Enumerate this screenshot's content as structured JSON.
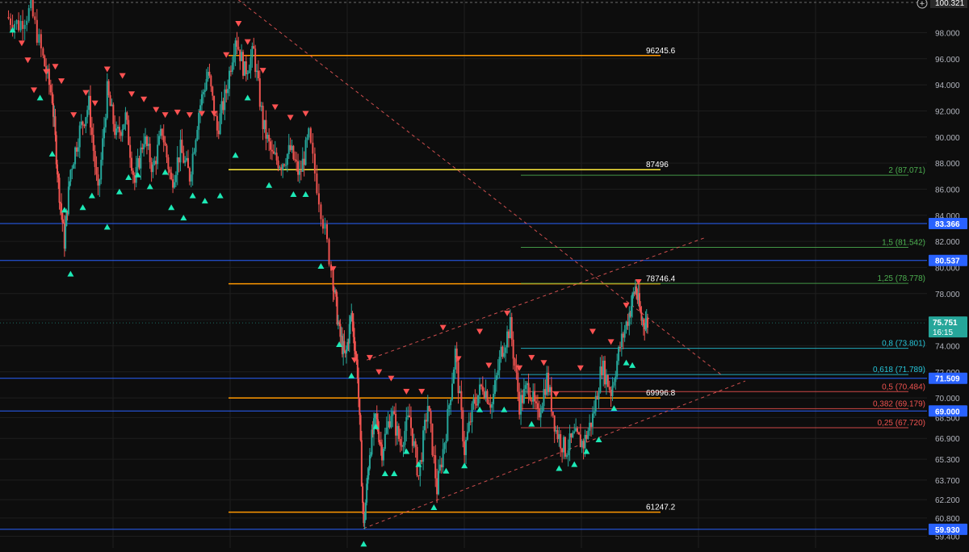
{
  "chart_data": {
    "type": "candlestick",
    "y_scale": "linear",
    "ylim": [
      58.5,
      100.5
    ],
    "grid": true,
    "colors": {
      "background": "#0d0d0d",
      "grid": "#1e1e1e",
      "axis_text": "#b2b5be",
      "up_candle": "#26a69a",
      "down_candle": "#ef5350",
      "pivot_high_marker": "#ff5252",
      "pivot_low_marker": "#1de9b6",
      "support_line": "#2962ff",
      "price_level": "#ff9800",
      "channel": "#f05a5a",
      "fib_upper": "#4caf50",
      "fib_mid": "#26c6da",
      "fib_lower": "#ef5350",
      "last_price_tag": "#26a69a",
      "yellow_level": "#ffeb3b"
    },
    "y_axis_ticks": [
      "98.000",
      "96.000",
      "94.000",
      "92.000",
      "90.000",
      "88.000",
      "86.000",
      "84.000",
      "82.000",
      "80.000",
      "78.000",
      "76.000",
      "74.000",
      "72.000",
      "70.000",
      "68.500",
      "66.900",
      "65.300",
      "63.700",
      "62.200",
      "60.800",
      "59.400"
    ],
    "y_axis_tick_values": [
      98,
      96,
      94,
      92,
      90,
      88,
      86,
      84,
      82,
      80,
      78,
      76,
      74,
      72,
      70,
      68.5,
      66.9,
      65.3,
      63.7,
      62.2,
      60.8,
      59.4
    ],
    "top_value_label": "100.321",
    "horizontal_support_lines": [
      {
        "label": "83.366",
        "value": 83.366
      },
      {
        "label": "80.537",
        "value": 80.537
      },
      {
        "label": "71.509",
        "value": 71.509
      },
      {
        "label": "69.000",
        "value": 69.0
      },
      {
        "label": "59.930",
        "value": 59.93
      }
    ],
    "price_levels": [
      {
        "label": "96245.6",
        "value": 96.2456,
        "color": "orange"
      },
      {
        "label": "87496",
        "value": 87.496,
        "color": "yellow"
      },
      {
        "label": "78746.4",
        "value": 78.7464,
        "color": "orange"
      },
      {
        "label": "69996.8",
        "value": 69.9968,
        "color": "orange"
      },
      {
        "label": "61247.2",
        "value": 61.2472,
        "color": "orange"
      }
    ],
    "fib_levels": [
      {
        "label": "2 (87.071)",
        "value": 87.071,
        "group": "upper"
      },
      {
        "label": "1,5 (81.542)",
        "value": 81.542,
        "group": "upper"
      },
      {
        "label": "1,25 (78.778)",
        "value": 78.778,
        "group": "upper"
      },
      {
        "label": "0,8 (73.801)",
        "value": 73.801,
        "group": "mid"
      },
      {
        "label": "0,618 (71.789)",
        "value": 71.789,
        "group": "mid"
      },
      {
        "label": "0,5 (70.484)",
        "value": 70.484,
        "group": "lower"
      },
      {
        "label": "0,382 (69.179)",
        "value": 69.179,
        "group": "lower"
      },
      {
        "label": "0,25 (67.720)",
        "value": 67.72,
        "group": "lower"
      }
    ],
    "last_price": {
      "value": 75.751,
      "label": "75.751",
      "countdown": "16:15"
    },
    "price_series": [
      {
        "t": 0.0,
        "v": 99.2
      },
      {
        "t": 0.04,
        "v": 98.6
      },
      {
        "t": 0.08,
        "v": 99.8
      },
      {
        "t": 0.12,
        "v": 96.0
      },
      {
        "t": 0.15,
        "v": 93.0
      },
      {
        "t": 0.17,
        "v": 86.5
      },
      {
        "t": 0.19,
        "v": 82.0
      },
      {
        "t": 0.21,
        "v": 87.5
      },
      {
        "t": 0.24,
        "v": 90.5
      },
      {
        "t": 0.27,
        "v": 92.5
      },
      {
        "t": 0.3,
        "v": 85.5
      },
      {
        "t": 0.33,
        "v": 93.5
      },
      {
        "t": 0.36,
        "v": 90.0
      },
      {
        "t": 0.39,
        "v": 91.5
      },
      {
        "t": 0.42,
        "v": 86.5
      },
      {
        "t": 0.45,
        "v": 90.0
      },
      {
        "t": 0.48,
        "v": 87.5
      },
      {
        "t": 0.51,
        "v": 90.5
      },
      {
        "t": 0.54,
        "v": 86.5
      },
      {
        "t": 0.57,
        "v": 89.0
      },
      {
        "t": 0.6,
        "v": 87.0
      },
      {
        "t": 0.63,
        "v": 92.0
      },
      {
        "t": 0.66,
        "v": 95.0
      },
      {
        "t": 0.69,
        "v": 90.5
      },
      {
        "t": 0.72,
        "v": 93.5
      },
      {
        "t": 0.75,
        "v": 97.8
      },
      {
        "t": 0.78,
        "v": 95.0
      },
      {
        "t": 0.81,
        "v": 96.5
      },
      {
        "t": 0.84,
        "v": 91.0
      },
      {
        "t": 0.87,
        "v": 88.5
      },
      {
        "t": 0.9,
        "v": 88.0
      },
      {
        "t": 0.93,
        "v": 89.0
      },
      {
        "t": 0.96,
        "v": 87.0
      },
      {
        "t": 0.99,
        "v": 90.0
      },
      {
        "t": 1.03,
        "v": 84.5
      },
      {
        "t": 1.07,
        "v": 79.0
      },
      {
        "t": 1.09,
        "v": 75.0
      },
      {
        "t": 1.11,
        "v": 73.0
      },
      {
        "t": 1.13,
        "v": 76.5
      },
      {
        "t": 1.15,
        "v": 72.0
      },
      {
        "t": 1.17,
        "v": 60.0
      },
      {
        "t": 1.19,
        "v": 66.0
      },
      {
        "t": 1.21,
        "v": 68.5
      },
      {
        "t": 1.23,
        "v": 66.0
      },
      {
        "t": 1.26,
        "v": 69.0
      },
      {
        "t": 1.29,
        "v": 66.5
      },
      {
        "t": 1.32,
        "v": 68.5
      },
      {
        "t": 1.35,
        "v": 64.0
      },
      {
        "t": 1.38,
        "v": 69.5
      },
      {
        "t": 1.41,
        "v": 63.0
      },
      {
        "t": 1.44,
        "v": 67.5
      },
      {
        "t": 1.47,
        "v": 73.5
      },
      {
        "t": 1.5,
        "v": 66.0
      },
      {
        "t": 1.53,
        "v": 69.5
      },
      {
        "t": 1.56,
        "v": 71.0
      },
      {
        "t": 1.59,
        "v": 69.5
      },
      {
        "t": 1.62,
        "v": 73.5
      },
      {
        "t": 1.65,
        "v": 75.5
      },
      {
        "t": 1.68,
        "v": 69.5
      },
      {
        "t": 1.71,
        "v": 71.0
      },
      {
        "t": 1.74,
        "v": 68.5
      },
      {
        "t": 1.77,
        "v": 71.5
      },
      {
        "t": 1.8,
        "v": 67.5
      },
      {
        "t": 1.83,
        "v": 66.0
      },
      {
        "t": 1.86,
        "v": 67.0
      },
      {
        "t": 1.89,
        "v": 66.5
      },
      {
        "t": 1.92,
        "v": 68.5
      },
      {
        "t": 1.95,
        "v": 72.5
      },
      {
        "t": 1.98,
        "v": 70.5
      },
      {
        "t": 2.01,
        "v": 74.0
      },
      {
        "t": 2.04,
        "v": 76.5
      },
      {
        "t": 2.06,
        "v": 78.5
      },
      {
        "t": 2.08,
        "v": 76.0
      },
      {
        "t": 2.1,
        "v": 75.75
      }
    ],
    "pivot_highs": [
      {
        "t": 0.05,
        "v": 96.9
      },
      {
        "t": 0.07,
        "v": 95.6
      },
      {
        "t": 0.09,
        "v": 93.3
      },
      {
        "t": 0.13,
        "v": 94.7
      },
      {
        "t": 0.16,
        "v": 95.1
      },
      {
        "t": 0.18,
        "v": 94.0
      },
      {
        "t": 0.22,
        "v": 91.4
      },
      {
        "t": 0.26,
        "v": 93.1
      },
      {
        "t": 0.29,
        "v": 92.3
      },
      {
        "t": 0.33,
        "v": 94.9
      },
      {
        "t": 0.38,
        "v": 94.4
      },
      {
        "t": 0.41,
        "v": 93.0
      },
      {
        "t": 0.45,
        "v": 92.6
      },
      {
        "t": 0.49,
        "v": 91.8
      },
      {
        "t": 0.52,
        "v": 91.4
      },
      {
        "t": 0.56,
        "v": 91.6
      },
      {
        "t": 0.6,
        "v": 91.4
      },
      {
        "t": 0.64,
        "v": 91.5
      },
      {
        "t": 0.68,
        "v": 91.5
      },
      {
        "t": 0.72,
        "v": 96.0
      },
      {
        "t": 0.76,
        "v": 98.4
      },
      {
        "t": 0.79,
        "v": 97.0
      },
      {
        "t": 0.84,
        "v": 94.8
      },
      {
        "t": 0.88,
        "v": 92.0
      },
      {
        "t": 0.93,
        "v": 91.2
      },
      {
        "t": 0.98,
        "v": 91.5
      },
      {
        "t": 1.07,
        "v": 79.6
      },
      {
        "t": 1.14,
        "v": 72.6
      },
      {
        "t": 1.19,
        "v": 72.8
      },
      {
        "t": 1.22,
        "v": 71.7
      },
      {
        "t": 1.26,
        "v": 71.2
      },
      {
        "t": 1.31,
        "v": 70.2
      },
      {
        "t": 1.36,
        "v": 70.2
      },
      {
        "t": 1.43,
        "v": 75.1
      },
      {
        "t": 1.48,
        "v": 72.7
      },
      {
        "t": 1.55,
        "v": 74.8
      },
      {
        "t": 1.58,
        "v": 72.2
      },
      {
        "t": 1.64,
        "v": 76.2
      },
      {
        "t": 1.68,
        "v": 72.0
      },
      {
        "t": 1.72,
        "v": 72.8
      },
      {
        "t": 1.76,
        "v": 72.4
      },
      {
        "t": 1.8,
        "v": 70.0
      },
      {
        "t": 1.88,
        "v": 72.0
      },
      {
        "t": 1.92,
        "v": 74.8
      },
      {
        "t": 1.98,
        "v": 74.0
      },
      {
        "t": 2.03,
        "v": 76.8
      },
      {
        "t": 2.07,
        "v": 78.6
      }
    ],
    "pivot_lows": [
      {
        "t": 0.02,
        "v": 98.5
      },
      {
        "t": 0.11,
        "v": 93.3
      },
      {
        "t": 0.15,
        "v": 89.0
      },
      {
        "t": 0.19,
        "v": 84.7
      },
      {
        "t": 0.21,
        "v": 79.8
      },
      {
        "t": 0.25,
        "v": 84.9
      },
      {
        "t": 0.28,
        "v": 85.8
      },
      {
        "t": 0.33,
        "v": 83.4
      },
      {
        "t": 0.37,
        "v": 86.1
      },
      {
        "t": 0.4,
        "v": 87.2
      },
      {
        "t": 0.43,
        "v": 87.4
      },
      {
        "t": 0.47,
        "v": 86.5
      },
      {
        "t": 0.52,
        "v": 87.6
      },
      {
        "t": 0.54,
        "v": 84.9
      },
      {
        "t": 0.58,
        "v": 84.1
      },
      {
        "t": 0.61,
        "v": 85.8
      },
      {
        "t": 0.65,
        "v": 85.4
      },
      {
        "t": 0.7,
        "v": 85.8
      },
      {
        "t": 0.75,
        "v": 88.9
      },
      {
        "t": 0.79,
        "v": 93.3
      },
      {
        "t": 0.86,
        "v": 86.6
      },
      {
        "t": 0.94,
        "v": 85.9
      },
      {
        "t": 0.98,
        "v": 85.9
      },
      {
        "t": 1.03,
        "v": 80.4
      },
      {
        "t": 1.09,
        "v": 74.4
      },
      {
        "t": 1.13,
        "v": 72.0
      },
      {
        "t": 1.17,
        "v": 59.1
      },
      {
        "t": 1.21,
        "v": 68.1
      },
      {
        "t": 1.24,
        "v": 64.5
      },
      {
        "t": 1.27,
        "v": 64.5
      },
      {
        "t": 1.31,
        "v": 66.2
      },
      {
        "t": 1.35,
        "v": 65.2
      },
      {
        "t": 1.4,
        "v": 61.9
      },
      {
        "t": 1.44,
        "v": 64.7
      },
      {
        "t": 1.5,
        "v": 65.1
      },
      {
        "t": 1.55,
        "v": 69.4
      },
      {
        "t": 1.63,
        "v": 69.4
      },
      {
        "t": 1.72,
        "v": 68.3
      },
      {
        "t": 1.81,
        "v": 64.9
      },
      {
        "t": 1.86,
        "v": 65.2
      },
      {
        "t": 1.9,
        "v": 66.2
      },
      {
        "t": 1.94,
        "v": 67.1
      },
      {
        "t": 1.99,
        "v": 69.5
      },
      {
        "t": 2.03,
        "v": 73.0
      },
      {
        "t": 2.05,
        "v": 72.8
      }
    ],
    "trendlines": [
      {
        "name": "",
        "from": {
          "t": 0.76,
          "v": 100.5
        },
        "to": {
          "t": 2.34,
          "v": 71.8
        },
        "style": "dashed"
      },
      {
        "name": "",
        "from": {
          "t": 1.17,
          "v": 60.0
        },
        "to": {
          "t": 2.42,
          "v": 71.3
        },
        "style": "dashed"
      },
      {
        "name": "",
        "from": {
          "t": 1.18,
          "v": 72.9
        },
        "to": {
          "t": 2.29,
          "v": 82.3
        },
        "style": "dashed"
      }
    ]
  }
}
